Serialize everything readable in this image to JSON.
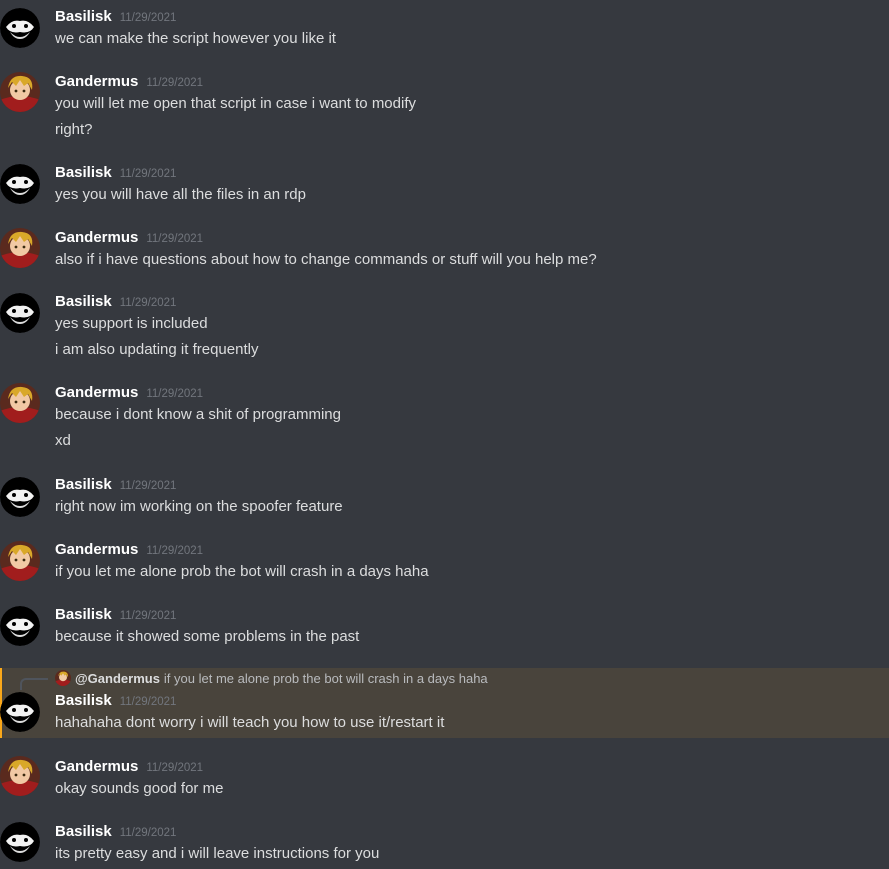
{
  "colors": {
    "background": "#36393f",
    "mention_background": "#49443c",
    "mention_bar": "#faa81a",
    "username": "#ffffff",
    "message_text": "#dcddde",
    "timestamp": "#72767d"
  },
  "avatar_icons": {
    "Basilisk": "masked-face-avatar-icon",
    "Gandermus": "anime-character-avatar-icon"
  },
  "messages": [
    {
      "author": "Basilisk",
      "timestamp": "11/29/2021",
      "lines": [
        "we can make the script however you like it"
      ]
    },
    {
      "author": "Gandermus",
      "timestamp": "11/29/2021",
      "lines": [
        "you will let me open that script in case i want to modify",
        "right?"
      ]
    },
    {
      "author": "Basilisk",
      "timestamp": "11/29/2021",
      "lines": [
        "yes you will have all the files in an rdp"
      ]
    },
    {
      "author": "Gandermus",
      "timestamp": "11/29/2021",
      "lines": [
        "also if i have questions about how to change commands or stuff will you help me?"
      ]
    },
    {
      "author": "Basilisk",
      "timestamp": "11/29/2021",
      "lines": [
        "yes support is included",
        "i am also updating it frequently"
      ]
    },
    {
      "author": "Gandermus",
      "timestamp": "11/29/2021",
      "lines": [
        "because i dont know a shit of programming",
        "xd"
      ]
    },
    {
      "author": "Basilisk",
      "timestamp": "11/29/2021",
      "lines": [
        "right now im working on the spoofer feature"
      ]
    },
    {
      "author": "Gandermus",
      "timestamp": "11/29/2021",
      "lines": [
        "if you let me alone prob the bot will crash in a days haha"
      ]
    },
    {
      "author": "Basilisk",
      "timestamp": "11/29/2021",
      "lines": [
        "because it showed some problems in the past"
      ]
    },
    {
      "author": "Basilisk",
      "timestamp": "11/29/2021",
      "reply": {
        "author": "@Gandermus",
        "text": "if you let me alone prob the bot will crash in a days haha"
      },
      "lines": [
        "hahahaha dont worry i will teach you how to use it/restart it"
      ]
    },
    {
      "author": "Gandermus",
      "timestamp": "11/29/2021",
      "lines": [
        "okay sounds good for me"
      ]
    },
    {
      "author": "Basilisk",
      "timestamp": "11/29/2021",
      "lines": [
        "its pretty easy and i will leave instructions for you"
      ]
    }
  ]
}
